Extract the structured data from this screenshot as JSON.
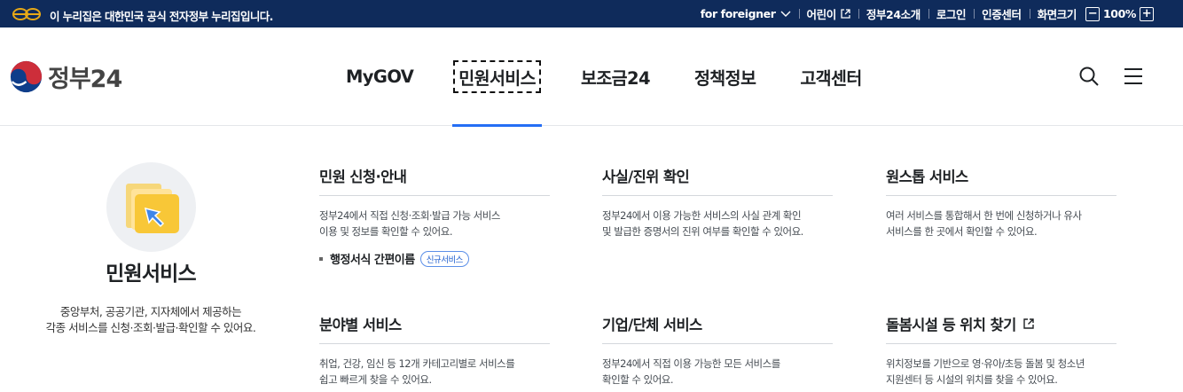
{
  "topbar": {
    "notice": "이 누리집은 대한민국 공식 전자정부 누리집입니다.",
    "links": {
      "foreigner": "for foreigner",
      "kids": "어린이",
      "about": "정부24소개",
      "login": "로그인",
      "cert": "인증센터",
      "zoom_label": "화면크기",
      "zoom_value": "100%"
    }
  },
  "header": {
    "brand": "정부24",
    "nav": [
      "MyGOV",
      "민원서비스",
      "보조금24",
      "정책정보",
      "고객센터"
    ],
    "active_nav": "민원서비스"
  },
  "menu": {
    "intro": {
      "title": "민원서비스",
      "desc_line1": "중앙부처, 공공기관, 지자체에서 제공하는",
      "desc_line2": "각종 서비스를 신청·조회·발급·확인할 수 있어요."
    },
    "cards": [
      {
        "title": "민원 신청·안내",
        "desc_line1": "정부24에서 직접 신청·조회·발급 가능 서비스",
        "desc_line2": "이용 및 정보를 확인할 수 있어요.",
        "sub": "행정서식 간편이름",
        "badge": "신규서비스"
      },
      {
        "title": "사실/진위 확인",
        "desc_line1": "정부24에서 이용 가능한 서비스의 사실 관계 확인",
        "desc_line2": "및 발급한 증명서의 진위 여부를 확인할 수 있어요."
      },
      {
        "title": "원스톱 서비스",
        "desc_line1": "여러 서비스를 통합해서 한 번에 신청하거나 유사",
        "desc_line2": "서비스를 한 곳에서 확인할 수 있어요."
      },
      {
        "title": "분야별 서비스",
        "desc_line1": "취업, 건강, 임신 등 12개 카테고리별로 서비스를",
        "desc_line2": "쉽고 빠르게 찾을 수 있어요."
      },
      {
        "title": "기업/단체 서비스",
        "desc_line1": "정부24에서 직접 이용 가능한 모든 서비스를",
        "desc_line2": "확인할 수 있어요."
      },
      {
        "title": "돌봄시설 등 위치 찾기",
        "desc_line1": "위치정보를 기반으로 영·유아/초등 돌봄 및 청소년",
        "desc_line2": "지원센터 등 시설의 위치를 찾을 수 있어요."
      }
    ]
  },
  "colors": {
    "topbar_bg": "#0f2b5b",
    "accent_blue": "#256ef4",
    "emblem_red": "#cd2e3a",
    "emblem_blue": "#0f3d8a"
  }
}
